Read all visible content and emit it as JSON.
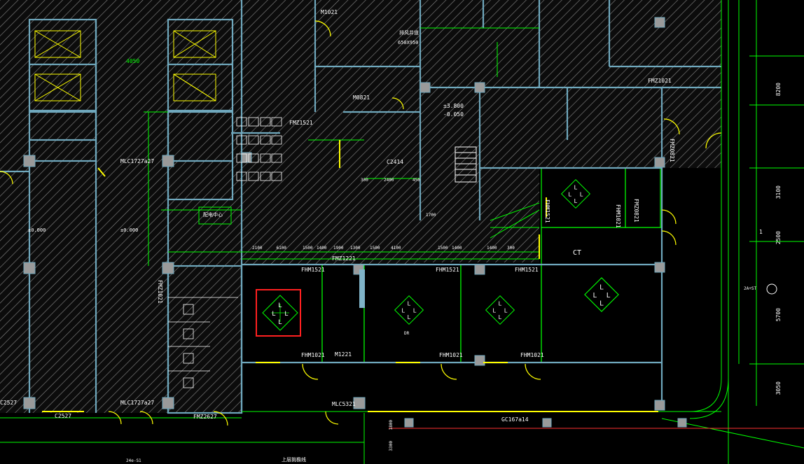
{
  "colors": {
    "background": "#000000",
    "hatch": "#7a7a7a",
    "wall": "#7fb3c8",
    "dimension": "#00ff00",
    "door": "#ffff00",
    "text": "#ffffff",
    "selection": "#ff2020",
    "grid_axis": "#ff0000"
  },
  "top": {
    "door_m1021": "M1021",
    "opening_650x950": "650X950",
    "shaft_label": "排风井道"
  },
  "left_block": {
    "dim_4050": "4050",
    "label_c2527_top": "C2527",
    "label_c2527_bottom": "C2527",
    "label_mlc": "MLC1727a27",
    "label_mlc_bottom": "MLC1727a27",
    "label_fmz": "FMZ1021",
    "label_fmz2627": "FMZ2627",
    "elevation_l1": "±0.000",
    "elevation_l2": "±0.000"
  },
  "center": {
    "elev_3800": "±3.800",
    "elev_050": "-0.050",
    "window_c2414": "C2414",
    "dim_2400": "2400",
    "dim_300": "300",
    "dim_450": "450",
    "dim_1700": "1700",
    "dim_1900": "1900",
    "dim_1300": "1300",
    "fmz_m1521": "FMZ1521",
    "fmz_m1221": "FMZ1221",
    "m0821": "M0821",
    "fm1521": "FHM1521",
    "fhm1221": "FHM1221",
    "fhm1021_a": "FHM1021",
    "fhm1021_b": "FHM1021",
    "fhm1021_c": "FHM1021",
    "m1221": "M1221",
    "fhm1521_a": "FHM1521",
    "fhm1521_b": "FHM1521",
    "fhm1521_c": "FHM1521",
    "fhm1521_side": "FHM1521",
    "fhm1021_side": "FHM1021",
    "fm_m0821": "FMZ0821",
    "ct_label": "CT",
    "dr_label": "DR",
    "mlc_label": "MLC5321",
    "label_center_box": "配电中心",
    "dims_row": [
      "2100",
      "6100",
      "1500",
      "1400",
      "1500",
      "4100",
      "1500",
      "1400",
      "1400",
      "300"
    ]
  },
  "right": {
    "dims_vertical": [
      "8200",
      "3100",
      "2500",
      "5700",
      "3050"
    ],
    "gc_label": "GC167a14",
    "axis_num": "1",
    "axis_label_2a": "2A+ST",
    "fm_label": "FMZ1021",
    "fmz_0821": "FMZ0821"
  },
  "bottom": {
    "dim_1800": "1800",
    "dim_3300": "3300",
    "label_bottom": "上层挑檐线",
    "axis_note": "24e-S1"
  },
  "icons": {
    "equipment_symbol": "four-L-diamond-icon",
    "selection": "red-selection-box"
  }
}
